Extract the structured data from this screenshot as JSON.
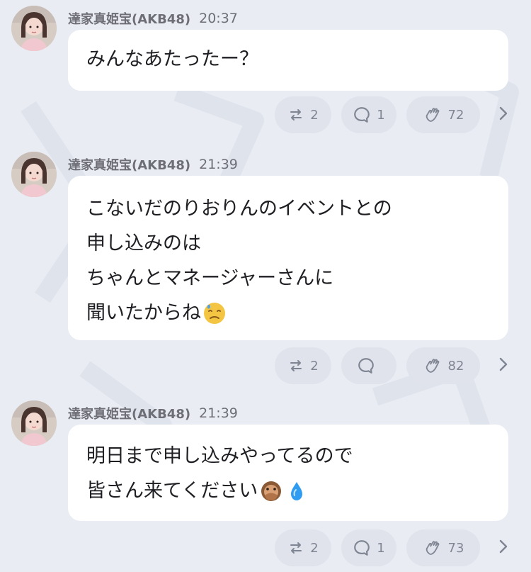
{
  "posts": [
    {
      "author": "達家真姫宝(AKB48)",
      "time": "20:37",
      "lines": [
        "みんなあたったー？"
      ],
      "reposts": "2",
      "comments": "1",
      "claps": "72"
    },
    {
      "author": "達家真姫宝(AKB48)",
      "time": "21:39",
      "lines": [
        "こないだのりおりんのイベントとの",
        "申し込みのは",
        "ちゃんとマネージャーさんに",
        "聞いたからね"
      ],
      "emoji": "downcast-face-with-sweat",
      "reposts": "2",
      "comments": "",
      "claps": "82"
    },
    {
      "author": "達家真姫宝(AKB48)",
      "time": "21:39",
      "lines": [
        "明日まで申し込みやってるので",
        "皆さん来てください"
      ],
      "emoji": [
        "speak-no-evil-monkey",
        "droplet"
      ],
      "reposts": "2",
      "comments": "1",
      "claps": "73"
    }
  ],
  "icons": {
    "repost": "repost-icon",
    "comment": "comment-icon",
    "clap": "clap-icon",
    "more": "chevron-right-icon"
  },
  "colors": {
    "background": "#e9ecf3",
    "bubble": "#ffffff",
    "pill": "#e0e3ec",
    "meta_text": "#6e6e76",
    "body_text": "#1f1f23",
    "action_text": "#808592"
  }
}
